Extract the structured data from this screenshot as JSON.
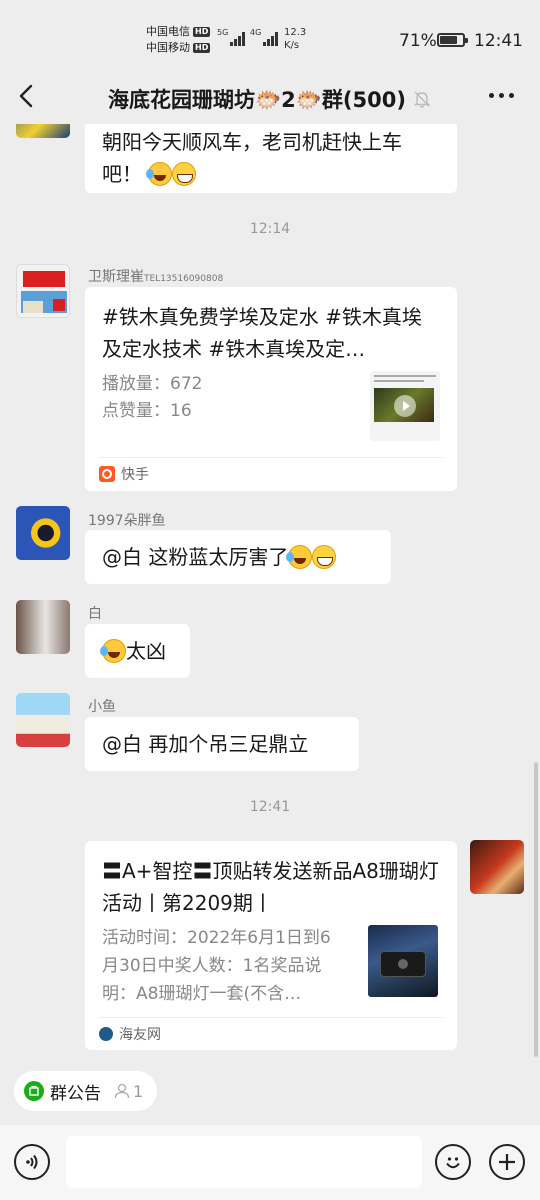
{
  "status_bar": {
    "carrier1": "中国电信",
    "carrier2": "中国移动",
    "hd": "HD",
    "net1": "5G",
    "net2": "4G",
    "speed_value": "12.3",
    "speed_unit": "K/s",
    "battery_pct": "71%",
    "battery_level": 0.71,
    "time": "12:41"
  },
  "header": {
    "title": "海底花园珊瑚坊🐡2🐡群(500)"
  },
  "messages": {
    "m0": {
      "line1": "朝阳今天顺风车，老司机赶快上车",
      "line2": "吧！"
    },
    "t1": "12:14",
    "m1": {
      "sender": "卫斯理崔",
      "sender_tel": "TEL13516090808",
      "title": "#铁木真免费学埃及定水 #铁木真埃及定水技术 #铁木真埃及定…",
      "plays_label": "播放量：",
      "plays": "672",
      "likes_label": "点赞量：",
      "likes": "16",
      "source": "快手"
    },
    "m2": {
      "sender": "1997朵胖鱼",
      "text": "@白  这粉蓝太厉害了"
    },
    "m3": {
      "sender": "白",
      "text": "太凶"
    },
    "m4": {
      "sender": "小鱼",
      "text": "@白  再加个吊三足鼎立"
    },
    "t2": "12:41",
    "m5": {
      "title": "〓A+智控〓顶贴转发送新品A8珊瑚灯活动丨第2209期丨",
      "desc": "活动时间：2022年6月1日到6月30日中奖人数：1名奖品说明：A8珊瑚灯一套(不含…",
      "source": "海友网"
    }
  },
  "notice": {
    "label": "群公告",
    "count": "1"
  },
  "input": {
    "placeholder": ""
  },
  "colors": {
    "bg": "#ededed",
    "bubble": "#ffffff",
    "accent": "#1aad19",
    "kuaishou": "#ff5a1f"
  }
}
